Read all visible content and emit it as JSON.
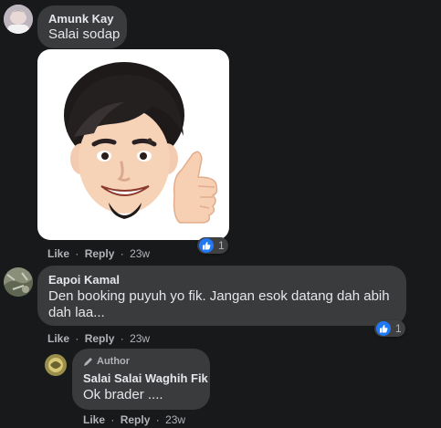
{
  "comments": [
    {
      "author": "Amunk Kay",
      "text": "Salai sodap",
      "like_label": "Like",
      "reply_label": "Reply",
      "time": "23w",
      "reactions": "1"
    },
    {
      "author": "Eapoi Kamal",
      "text_line1": "Den booking puyuh yo fik. Jangan esok datang dah abih",
      "text_line2": "dah laa...",
      "like_label": "Like",
      "reply_label": "Reply",
      "time": "23w",
      "reactions": "1"
    },
    {
      "badge": "Author",
      "author": "Salai Salai Waghih Fik",
      "text": "Ok brader ....",
      "like_label": "Like",
      "reply_label": "Reply",
      "time": "23w"
    }
  ],
  "separator": "·",
  "colors": {
    "background": "#18191a",
    "bubble": "#3a3b3c",
    "like_blue": "#2078f4",
    "secondary_text": "#b0b3b8"
  }
}
